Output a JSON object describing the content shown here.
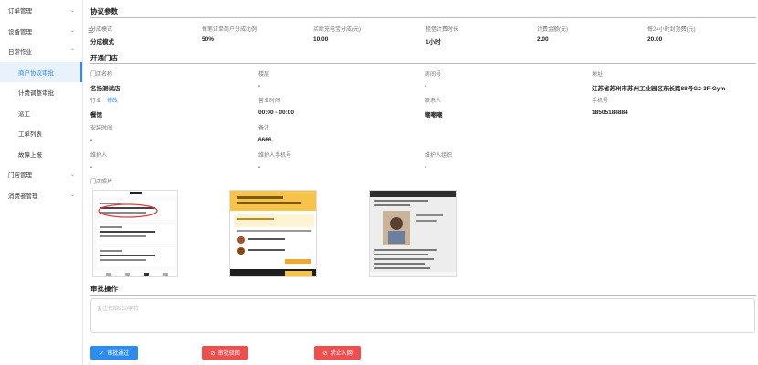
{
  "sidebar": {
    "items": [
      {
        "label": "订单管理",
        "chevron": "⌄"
      },
      {
        "label": "设备管理",
        "chevron": "⌄"
      },
      {
        "label": "日常作业",
        "chevron": "⌃"
      },
      {
        "label": "商户协议审批",
        "sub": true,
        "active": true
      },
      {
        "label": "计费调整审批",
        "sub": true
      },
      {
        "label": "派工",
        "sub": true
      },
      {
        "label": "工单列表",
        "sub": true
      },
      {
        "label": "故障上报",
        "sub": true
      },
      {
        "label": "门店管理",
        "chevron": "⌄"
      },
      {
        "label": "消费者管理",
        "chevron": "⌄"
      }
    ]
  },
  "protocol": {
    "title": "协议参数",
    "menu_icon": "☰",
    "labels": [
      "分成模式",
      "每笔订单商户分成比例",
      "买断充电宝分成(元)",
      "租借计费时长",
      "计费金额(元)",
      "每24小时封顶费(元)"
    ],
    "values": [
      "分成模式",
      "50%",
      "10.00",
      "1小时",
      "2.00",
      "20.00"
    ]
  },
  "store": {
    "title": "开通门店",
    "row1_labels": [
      "门店名称",
      "楼层",
      "房间号",
      "地址"
    ],
    "row1_values": [
      "名扬测试店",
      "-",
      "-",
      "江苏省苏州市苏州工业园区东长路88号G2-3F-Gym"
    ],
    "row2_labels": [
      "行业",
      "营业时间",
      "联系人",
      "手机号"
    ],
    "industry_edit": "修改",
    "row2_values": [
      "餐馆",
      "00:00 - 00:00",
      "嘲嘲嘲",
      "18505188884"
    ],
    "row3_labels": [
      "安装时间",
      "备注"
    ],
    "row3_values": [
      "-",
      "6666"
    ],
    "row4_labels": [
      "维护人",
      "维护人手机号",
      "维护人组织"
    ],
    "row4_values": [
      "-",
      "-",
      "-"
    ],
    "photos_label": "门店照片"
  },
  "approval": {
    "title": "审批操作",
    "placeholder": "备注仅限250字符",
    "approve": "审批通过",
    "reject": "审批驳回",
    "ban": "禁止入网"
  },
  "colors": {
    "primary": "#2d8cf0",
    "danger": "#ed4f4f"
  }
}
